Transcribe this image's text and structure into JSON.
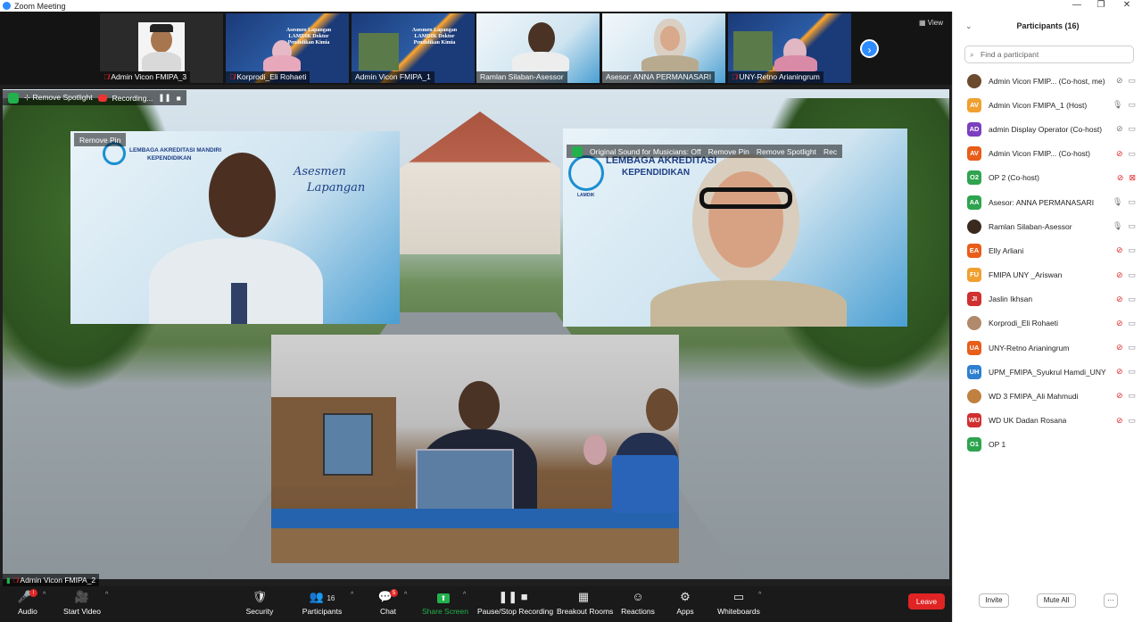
{
  "window": {
    "title": "Zoom Meeting",
    "controls": [
      "—",
      "❐",
      "✕"
    ]
  },
  "strip": {
    "view_label": "View",
    "next_arrow": "›",
    "thumbnails": [
      {
        "name": "Admin Vicon FMIPA_3",
        "type": "person"
      },
      {
        "name": "Korprodi_Eli Rohaeti",
        "type": "banner"
      },
      {
        "name": "Admin Vicon FMIPA_1",
        "type": "banner"
      },
      {
        "name": "Ramlan Silaban-Asessor",
        "type": "person"
      },
      {
        "name": "Asesor: ANNA PERMANASARI",
        "type": "person"
      },
      {
        "name": "UNY-Retno Arianingrum",
        "type": "banner"
      }
    ],
    "banner_text": "Asesmen Lapangan LAMDIK Doktor Pendidikan Kimia"
  },
  "spotlight_bar": {
    "remove_spotlight": "Remove Spotlight",
    "recording": "Recording...",
    "pause": "❚❚",
    "stop": "■"
  },
  "tiles": {
    "tile_a": {
      "overlay": "Remove Pin",
      "org_line1": "LEMBAGA AKREDITASI MANDIRI",
      "org_line2": "KEPENDIDIKAN",
      "script_line1": "Asesmen",
      "script_line2": "Lapangan"
    },
    "tile_b": {
      "overlay_sound": "Original Sound for Musicians: Off",
      "overlay_pin": "Remove Pin",
      "overlay_spotlight": "Remove Spotlight",
      "overlay_rec": "Rec",
      "org_line1": "LEMBAGA AKREDITASI",
      "org_line2": "KEPENDIDIKAN",
      "logo_label": "LAMDIK"
    }
  },
  "main_name": "Admin Vicon FMIPA_2",
  "toolbar": {
    "items": [
      {
        "label": "Audio",
        "icon": "🎤"
      },
      {
        "label": "Start Video",
        "icon": "🎥"
      },
      {
        "label": "Security",
        "icon": "🛡"
      },
      {
        "label": "Participants",
        "icon": "👥",
        "count": "16"
      },
      {
        "label": "Chat",
        "icon": "💬",
        "badge": "5"
      },
      {
        "label": "Share Screen",
        "icon": "⬆"
      },
      {
        "label": "Pause/Stop Recording",
        "icon": "❚❚ ■"
      },
      {
        "label": "Breakout Rooms",
        "icon": "▦"
      },
      {
        "label": "Reactions",
        "icon": "☺"
      },
      {
        "label": "Apps",
        "icon": "⚙"
      },
      {
        "label": "Whiteboards",
        "icon": "▭"
      }
    ],
    "leave": "Leave"
  },
  "participants_panel": {
    "title": "Participants (16)",
    "search_placeholder": "Find a participant",
    "participants": [
      {
        "initials": "",
        "name": "Admin Vicon FMIP... (Co-host, me)",
        "color": "#6b4a2e",
        "mic": "muted-gray",
        "cam": "on"
      },
      {
        "initials": "AV",
        "name": "Admin Vicon FMIPA_1 (Host)",
        "color": "#f0a030",
        "mic": "on",
        "cam": "on"
      },
      {
        "initials": "AD",
        "name": "admin Display Operator (Co-host)",
        "color": "#7b3fbf",
        "mic": "muted-gray",
        "cam": "on"
      },
      {
        "initials": "AV",
        "name": "Admin Vicon FMIP... (Co-host)",
        "color": "#e85d1a",
        "mic": "muted",
        "cam": "on"
      },
      {
        "initials": "O2",
        "name": "OP 2 (Co-host)",
        "color": "#2ea44f",
        "mic": "muted",
        "cam": "off"
      },
      {
        "initials": "AA",
        "name": "Asesor: ANNA PERMANASARI",
        "color": "#2ea44f",
        "mic": "on",
        "cam": "on"
      },
      {
        "initials": "",
        "name": "Ramlan Silaban-Asessor",
        "color": "#3a2a1e",
        "mic": "on",
        "cam": "on"
      },
      {
        "initials": "EA",
        "name": "Elly Arliani",
        "color": "#e85d1a",
        "mic": "muted",
        "cam": "on"
      },
      {
        "initials": "FU",
        "name": "FMIPA UNY _Ariswan",
        "color": "#f0a030",
        "mic": "muted",
        "cam": "on"
      },
      {
        "initials": "JI",
        "name": "Jaslin Ikhsan",
        "color": "#d03030",
        "mic": "muted",
        "cam": "on"
      },
      {
        "initials": "",
        "name": "Korprodi_Eli Rohaeti",
        "color": "#b08a6a",
        "mic": "muted",
        "cam": "on"
      },
      {
        "initials": "UA",
        "name": "UNY-Retno Arianingrum",
        "color": "#e85d1a",
        "mic": "muted",
        "cam": "on"
      },
      {
        "initials": "UH",
        "name": "UPM_FMIPA_Syukrul Hamdi_UNY",
        "color": "#2f7fd0",
        "mic": "muted",
        "cam": "on"
      },
      {
        "initials": "",
        "name": "WD 3 FMIPA_Ali Mahmudi",
        "color": "#c08040",
        "mic": "muted",
        "cam": "on"
      },
      {
        "initials": "WU",
        "name": "WD UK Dadan Rosana",
        "color": "#d03030",
        "mic": "muted",
        "cam": "on"
      },
      {
        "initials": "O1",
        "name": "OP 1",
        "color": "#2ea44f",
        "mic": "none",
        "cam": "none"
      }
    ],
    "invite": "Invite",
    "mute_all": "Mute All",
    "more": "···"
  }
}
